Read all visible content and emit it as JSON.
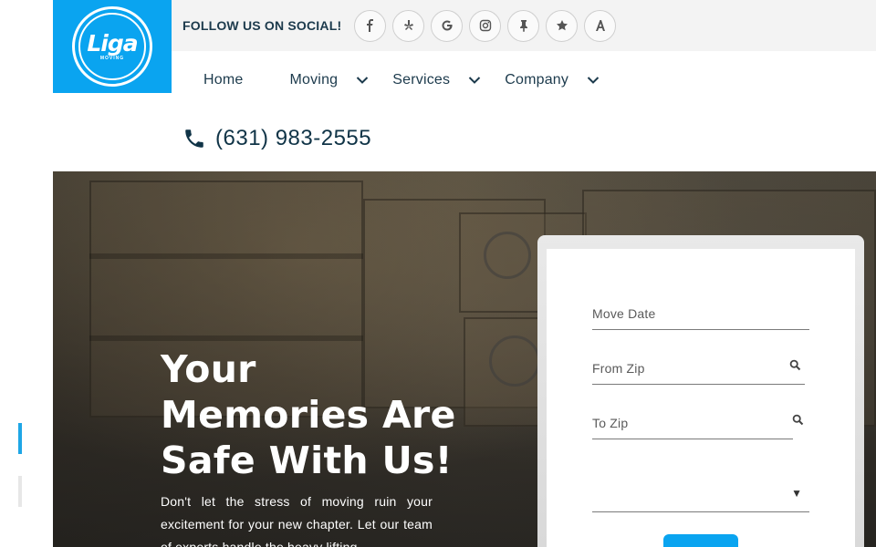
{
  "brand": {
    "logo_text": "Liga",
    "logo_subtext": "MOVING",
    "accent_color": "#0aa4f0"
  },
  "social": {
    "label": "FOLLOW US ON SOCIAL!",
    "icons": [
      "facebook-icon",
      "yelp-icon",
      "google-icon",
      "instagram-icon",
      "pin-icon",
      "star-icon",
      "angi-icon"
    ]
  },
  "nav": {
    "items": [
      {
        "label": "Home",
        "has_dropdown": false
      },
      {
        "label": "Moving",
        "has_dropdown": true
      },
      {
        "label": "Services",
        "has_dropdown": true
      },
      {
        "label": "Company",
        "has_dropdown": true
      }
    ]
  },
  "contact": {
    "phone": "(631) 983-2555"
  },
  "hero": {
    "headline_lines": [
      "Your",
      "Memories Are",
      "Safe With Us!"
    ],
    "lead": "Don't let the stress of moving ruin your excitement for your new chapter. Let our team of experts handle the heavy lifting"
  },
  "quote_form": {
    "move_date_placeholder": "Move Date",
    "from_zip_placeholder": "From Zip",
    "to_zip_placeholder": "To Zip",
    "move_size_value": "",
    "submit_label": ""
  }
}
